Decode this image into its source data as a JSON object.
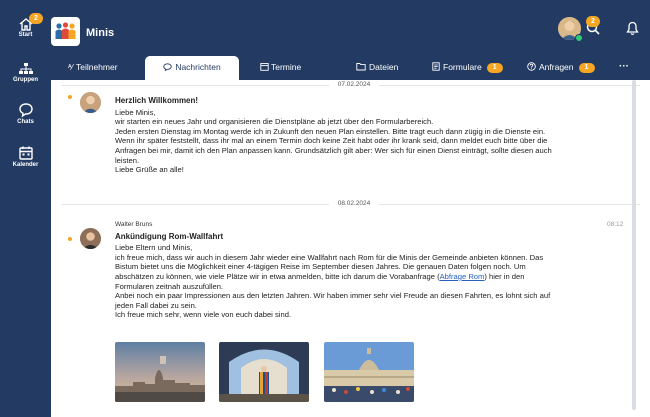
{
  "rail": {
    "start_label": "Start",
    "start_badge": "2",
    "groups_label": "Gruppen",
    "chats_label": "Chats",
    "calendar_label": "Kalender"
  },
  "header": {
    "team_name": "Minis",
    "notification_badge": "2"
  },
  "tabs": [
    {
      "label": "Teilnehmer",
      "icon": "people-icon"
    },
    {
      "label": "Nachrichten",
      "icon": "speech-bubble-icon"
    },
    {
      "label": "Termine",
      "icon": "calendar-icon"
    },
    {
      "label": "Dateien",
      "icon": "folder-icon"
    },
    {
      "label": "Formulare",
      "icon": "form-icon",
      "badge": "1"
    },
    {
      "label": "Anfragen",
      "icon": "question-icon",
      "badge": "1"
    },
    {
      "label": "···",
      "icon": "more-icon"
    }
  ],
  "messages": [
    {
      "date": "07.02.2024",
      "author": "",
      "time": "",
      "title": "Herzlich Willkommen!",
      "lines": [
        "Liebe Minis,",
        "wir starten ein neues Jahr und organisieren die Dienstpläne ab jetzt über den Formularbereich.",
        "Jeden ersten Dienstag im Montag werde ich in Zukunft den neuen Plan einstellen. Bitte tragt euch dann zügig in die Dienste ein.",
        "Wenn ihr später feststellt, dass ihr mal an einem Termin doch keine Zeit habt oder ihr krank seid, dann meldet euch bitte über die",
        "Anfragen bei mir, damit ich den Plan anpassen kann. Grundsätzlich gilt aber: Wer sich für einen Dienst einträgt, sollte diesen auch",
        "leisten.",
        "Liebe Grüße an alle!"
      ]
    },
    {
      "date": "08.02.2024",
      "author": "Walter Bruns",
      "time": "08:12",
      "title": "Ankündigung Rom-Wallfahrt",
      "lines": [
        "Liebe Eltern und Minis,",
        "ich freue mich, dass wir auch in diesem Jahr wieder eine Wallfahrt nach Rom für die Minis der Gemeinde anbieten können. Das",
        "Bistum bietet uns die Möglichkeit einer 4-tägigen Reise im September diesen Jahres. Die genauen Daten folgen noch. Um",
        "abschätzen zu können, wie viele Plätze wir in etwa anmelden, bitte ich darum die Vorabanfrage ("
      ],
      "link_text": "Abfrage Rom",
      "lines_after_link": ") hier in den",
      "lines_rest": [
        "Formularen zeitnah auszufüllen.",
        "Anbei noch ein paar Impressionen aus den letzten Jahren. Wir haben immer sehr viel Freude an diesen Fahrten, es lohnt sich auf",
        "jeden Fall dabei zu sein.",
        "Ich freue mich sehr, wenn viele von euch dabei sind."
      ]
    }
  ],
  "colors": {
    "sidebar": "#233b63",
    "accent": "#f5a623",
    "link": "#2660c0"
  }
}
